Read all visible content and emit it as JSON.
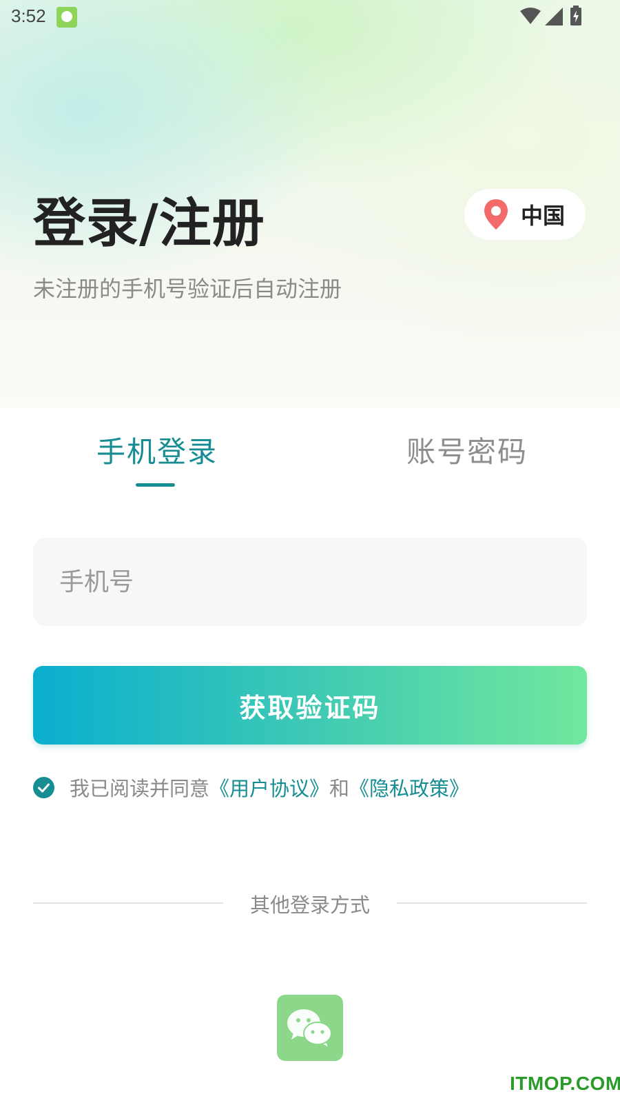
{
  "status_bar": {
    "time": "3:52"
  },
  "header": {
    "title": "登录/注册",
    "subtitle": "未注册的手机号验证后自动注册",
    "region": {
      "label": "中国",
      "icon": "location-pin-icon",
      "icon_color": "#f26a6a"
    }
  },
  "tabs": [
    {
      "label": "手机登录",
      "active": true
    },
    {
      "label": "账号密码",
      "active": false
    }
  ],
  "form": {
    "phone_placeholder": "手机号",
    "phone_value": "",
    "submit_label": "获取验证码"
  },
  "agreement": {
    "checked": true,
    "prefix": "我已阅读并同意",
    "user_agreement": "《用户协议》",
    "connector": "和",
    "privacy_policy": "《隐私政策》"
  },
  "other_login": {
    "label": "其他登录方式",
    "methods": [
      {
        "name": "wechat",
        "icon": "wechat-icon",
        "color": "#8dd78a"
      }
    ]
  },
  "watermark": "ITMOP.COM",
  "colors": {
    "accent": "#168d93",
    "button_gradient_start": "#0aafcf",
    "button_gradient_end": "#72e89e"
  }
}
